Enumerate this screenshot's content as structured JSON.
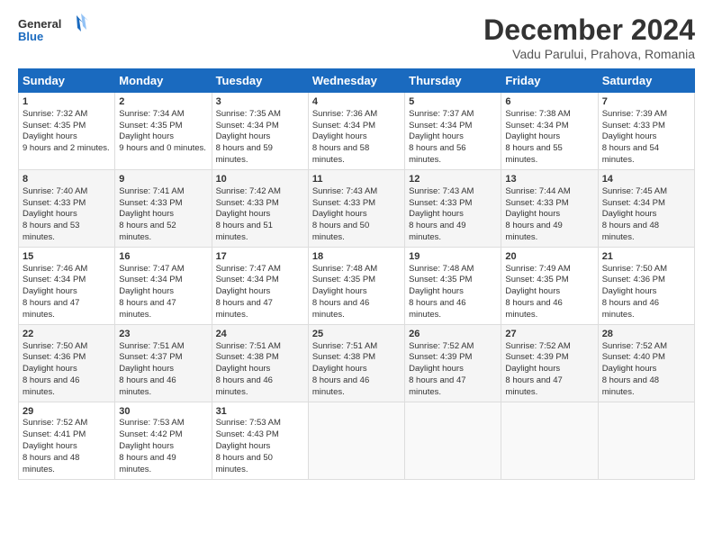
{
  "header": {
    "logo_line1": "General",
    "logo_line2": "Blue",
    "title": "December 2024",
    "subtitle": "Vadu Parului, Prahova, Romania"
  },
  "days_of_week": [
    "Sunday",
    "Monday",
    "Tuesday",
    "Wednesday",
    "Thursday",
    "Friday",
    "Saturday"
  ],
  "weeks": [
    [
      {
        "day": 1,
        "rise": "7:32 AM",
        "set": "4:35 PM",
        "daylight": "9 hours and 2 minutes."
      },
      {
        "day": 2,
        "rise": "7:34 AM",
        "set": "4:35 PM",
        "daylight": "9 hours and 0 minutes."
      },
      {
        "day": 3,
        "rise": "7:35 AM",
        "set": "4:34 PM",
        "daylight": "8 hours and 59 minutes."
      },
      {
        "day": 4,
        "rise": "7:36 AM",
        "set": "4:34 PM",
        "daylight": "8 hours and 58 minutes."
      },
      {
        "day": 5,
        "rise": "7:37 AM",
        "set": "4:34 PM",
        "daylight": "8 hours and 56 minutes."
      },
      {
        "day": 6,
        "rise": "7:38 AM",
        "set": "4:34 PM",
        "daylight": "8 hours and 55 minutes."
      },
      {
        "day": 7,
        "rise": "7:39 AM",
        "set": "4:33 PM",
        "daylight": "8 hours and 54 minutes."
      }
    ],
    [
      {
        "day": 8,
        "rise": "7:40 AM",
        "set": "4:33 PM",
        "daylight": "8 hours and 53 minutes."
      },
      {
        "day": 9,
        "rise": "7:41 AM",
        "set": "4:33 PM",
        "daylight": "8 hours and 52 minutes."
      },
      {
        "day": 10,
        "rise": "7:42 AM",
        "set": "4:33 PM",
        "daylight": "8 hours and 51 minutes."
      },
      {
        "day": 11,
        "rise": "7:43 AM",
        "set": "4:33 PM",
        "daylight": "8 hours and 50 minutes."
      },
      {
        "day": 12,
        "rise": "7:43 AM",
        "set": "4:33 PM",
        "daylight": "8 hours and 49 minutes."
      },
      {
        "day": 13,
        "rise": "7:44 AM",
        "set": "4:33 PM",
        "daylight": "8 hours and 49 minutes."
      },
      {
        "day": 14,
        "rise": "7:45 AM",
        "set": "4:34 PM",
        "daylight": "8 hours and 48 minutes."
      }
    ],
    [
      {
        "day": 15,
        "rise": "7:46 AM",
        "set": "4:34 PM",
        "daylight": "8 hours and 47 minutes."
      },
      {
        "day": 16,
        "rise": "7:47 AM",
        "set": "4:34 PM",
        "daylight": "8 hours and 47 minutes."
      },
      {
        "day": 17,
        "rise": "7:47 AM",
        "set": "4:34 PM",
        "daylight": "8 hours and 47 minutes."
      },
      {
        "day": 18,
        "rise": "7:48 AM",
        "set": "4:35 PM",
        "daylight": "8 hours and 46 minutes."
      },
      {
        "day": 19,
        "rise": "7:48 AM",
        "set": "4:35 PM",
        "daylight": "8 hours and 46 minutes."
      },
      {
        "day": 20,
        "rise": "7:49 AM",
        "set": "4:35 PM",
        "daylight": "8 hours and 46 minutes."
      },
      {
        "day": 21,
        "rise": "7:50 AM",
        "set": "4:36 PM",
        "daylight": "8 hours and 46 minutes."
      }
    ],
    [
      {
        "day": 22,
        "rise": "7:50 AM",
        "set": "4:36 PM",
        "daylight": "8 hours and 46 minutes."
      },
      {
        "day": 23,
        "rise": "7:51 AM",
        "set": "4:37 PM",
        "daylight": "8 hours and 46 minutes."
      },
      {
        "day": 24,
        "rise": "7:51 AM",
        "set": "4:38 PM",
        "daylight": "8 hours and 46 minutes."
      },
      {
        "day": 25,
        "rise": "7:51 AM",
        "set": "4:38 PM",
        "daylight": "8 hours and 46 minutes."
      },
      {
        "day": 26,
        "rise": "7:52 AM",
        "set": "4:39 PM",
        "daylight": "8 hours and 47 minutes."
      },
      {
        "day": 27,
        "rise": "7:52 AM",
        "set": "4:39 PM",
        "daylight": "8 hours and 47 minutes."
      },
      {
        "day": 28,
        "rise": "7:52 AM",
        "set": "4:40 PM",
        "daylight": "8 hours and 48 minutes."
      }
    ],
    [
      {
        "day": 29,
        "rise": "7:52 AM",
        "set": "4:41 PM",
        "daylight": "8 hours and 48 minutes."
      },
      {
        "day": 30,
        "rise": "7:53 AM",
        "set": "4:42 PM",
        "daylight": "8 hours and 49 minutes."
      },
      {
        "day": 31,
        "rise": "7:53 AM",
        "set": "4:43 PM",
        "daylight": "8 hours and 50 minutes."
      },
      null,
      null,
      null,
      null
    ]
  ]
}
